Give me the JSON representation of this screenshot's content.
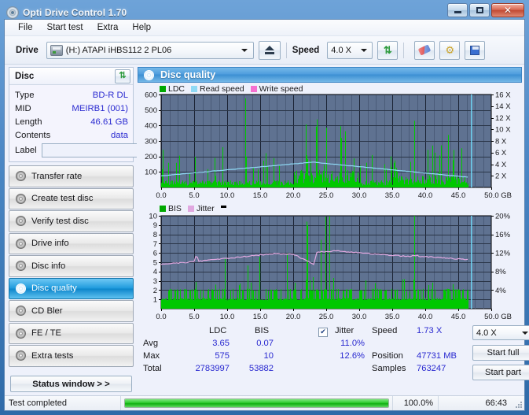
{
  "window": {
    "title": "Opti Drive Control 1.70",
    "icon": "disc-icon",
    "controls": {
      "minimize": "minimize-icon",
      "maximize": "maximize-icon",
      "close": "✕"
    }
  },
  "menu": {
    "items": [
      "File",
      "Start test",
      "Extra",
      "Help"
    ]
  },
  "toolbar": {
    "drive_label": "Drive",
    "drive_value": "(H:)  ATAPI iHBS112  2 PL06",
    "eject_icon": "eject-icon",
    "speed_label": "Speed",
    "speed_value": "4.0 X",
    "refresh_icon": "refresh-icon",
    "erase_icon": "eraser-icon",
    "settings_icon": "settings-icon",
    "save_icon": "save-icon"
  },
  "disc_panel": {
    "title": "Disc",
    "refresh_icon": "refresh-icon",
    "rows": [
      {
        "key": "Type",
        "value": "BD-R DL"
      },
      {
        "key": "MID",
        "value": "MEIRB1 (001)"
      },
      {
        "key": "Length",
        "value": "46.61 GB"
      },
      {
        "key": "Contents",
        "value": "data"
      }
    ],
    "label_key": "Label",
    "label_value": "",
    "label_placeholder": "",
    "cd_icon": "disc-icon"
  },
  "nav": {
    "items": [
      {
        "label": "Transfer rate",
        "active": false
      },
      {
        "label": "Create test disc",
        "active": false
      },
      {
        "label": "Verify test disc",
        "active": false
      },
      {
        "label": "Drive info",
        "active": false
      },
      {
        "label": "Disc info",
        "active": false
      },
      {
        "label": "Disc quality",
        "active": true
      },
      {
        "label": "CD Bler",
        "active": false
      },
      {
        "label": "FE / TE",
        "active": false
      },
      {
        "label": "Extra tests",
        "active": false
      }
    ],
    "status_window": "Status window > >"
  },
  "content_header": {
    "title": "Disc quality",
    "icon": "disc-icon"
  },
  "chart_data": [
    {
      "type": "bar",
      "id": "ldc-chart",
      "title": "",
      "xlabel": "GB",
      "ylabel": "",
      "ylim": [
        0,
        600
      ],
      "y2lim": [
        0,
        16
      ],
      "xlim": [
        0,
        50
      ],
      "grid": true,
      "legend_position": "top-left",
      "legend": [
        {
          "name": "LDC",
          "color": "#00a800"
        },
        {
          "name": "Read speed",
          "color": "#8fd9f5"
        },
        {
          "name": "Write speed",
          "color": "#f570d0"
        }
      ],
      "yticks": [
        100,
        200,
        300,
        400,
        500,
        600
      ],
      "ytick_labels": [
        "100",
        "200",
        "300",
        "400",
        "500",
        "600"
      ],
      "y2ticks": [
        2,
        4,
        6,
        8,
        10,
        12,
        14,
        16
      ],
      "y2tick_labels": [
        "2 X",
        "4 X",
        "6 X",
        "8 X",
        "10 X",
        "12 X",
        "14 X",
        "16 X"
      ],
      "xticks": [
        0,
        5,
        10,
        15,
        20,
        25,
        30,
        35,
        40,
        45,
        50
      ],
      "xtick_labels": [
        "0.0",
        "5.0",
        "10.0",
        "15.0",
        "20.0",
        "25.0",
        "30.0",
        "35.0",
        "40.0",
        "45.0",
        "50.0 GB"
      ],
      "series": [
        {
          "name": "LDC",
          "color": "#00c800",
          "note": "error spikes, dense baseline ~20-60, big cluster 20-30 GB, max 575 near 12.7 GB"
        },
        {
          "name": "Read speed",
          "color": "#8fd9f5",
          "note": "rises 2.0X at 0 GB to ~4.3X at 23 GB then falls to ~1.7X at 46.6 GB"
        }
      ]
    },
    {
      "type": "bar",
      "id": "bis-chart",
      "title": "",
      "xlabel": "GB",
      "ylabel": "",
      "ylim": [
        0,
        10
      ],
      "y2lim": [
        0,
        20
      ],
      "xlim": [
        0,
        50
      ],
      "grid": true,
      "legend_position": "top-left",
      "legend": [
        {
          "name": "BIS",
          "color": "#00a800"
        },
        {
          "name": "Jitter",
          "color": "#e0a8e0"
        }
      ],
      "yticks": [
        1,
        2,
        3,
        4,
        5,
        6,
        7,
        8,
        9,
        10
      ],
      "ytick_labels": [
        "1",
        "2",
        "3",
        "4",
        "5",
        "6",
        "7",
        "8",
        "9",
        "10"
      ],
      "y2ticks": [
        4,
        8,
        12,
        16,
        20
      ],
      "y2tick_labels": [
        "4%",
        "8%",
        "12%",
        "16%",
        "20%"
      ],
      "xticks": [
        0,
        5,
        10,
        15,
        20,
        25,
        30,
        35,
        40,
        45,
        50
      ],
      "xtick_labels": [
        "0.0",
        "5.0",
        "10.0",
        "15.0",
        "20.0",
        "25.0",
        "30.0",
        "35.0",
        "40.0",
        "45.0",
        "50.0 GB"
      ],
      "series": [
        {
          "name": "BIS",
          "color": "#00c800",
          "note": "baseline ~1, frequent spikes to 2-3, many to 7-10 in 20-27 GB region, max 10"
        },
        {
          "name": "Jitter",
          "color": "#e0a8e0",
          "note": "starts ~9.6%, rises to ~11.8% by 15-20 GB, dips to 9.6% at 23 GB, ~12.3% at 25-30 GB, falls to ~10.6% at 46 GB"
        }
      ]
    }
  ],
  "stats": {
    "col_headers": [
      "LDC",
      "BIS"
    ],
    "row_headers": [
      "Avg",
      "Max",
      "Total"
    ],
    "ldc": {
      "avg": "3.65",
      "max": "575",
      "total": "2783997"
    },
    "bis": {
      "avg": "0.07",
      "max": "10",
      "total": "53882"
    },
    "jitter": {
      "label": "Jitter",
      "checked": true,
      "avg": "11.0%",
      "max": "12.6%"
    },
    "speed": {
      "label": "Speed",
      "value": "1.73 X"
    },
    "position": {
      "label": "Position",
      "value": "47731 MB"
    },
    "samples": {
      "label": "Samples",
      "value": "763247"
    },
    "speed_select": "4.0 X",
    "start_full": "Start full",
    "start_part": "Start part"
  },
  "statusbar": {
    "text": "Test completed",
    "progress_pct": "100.0%",
    "progress_value": 100,
    "time": "66:43"
  },
  "colors": {
    "accent": "#3c8fd3",
    "plot_bg": "#5f7291",
    "ldc_green": "#00c800",
    "read_speed": "#8fd9f5",
    "write_speed": "#f570d0",
    "jitter": "#e0a8e0",
    "value_blue": "#2a2ad0"
  }
}
